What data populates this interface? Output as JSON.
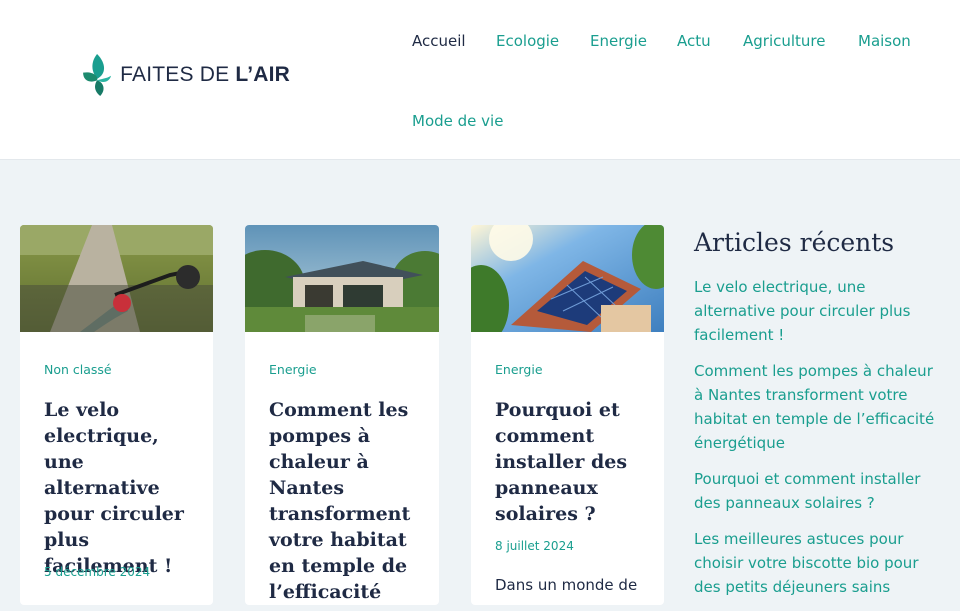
{
  "brand": {
    "name_light": "FAITES DE ",
    "name_bold": "L’AIR",
    "accent": "#1a9e8f"
  },
  "nav": {
    "items": [
      {
        "label": "Accueil",
        "active": true
      },
      {
        "label": "Ecologie",
        "active": false
      },
      {
        "label": "Energie",
        "active": false
      },
      {
        "label": "Actu",
        "active": false
      },
      {
        "label": "Agriculture",
        "active": false
      },
      {
        "label": "Maison",
        "active": false
      },
      {
        "label": "Mode de vie",
        "active": false
      }
    ]
  },
  "posts": [
    {
      "category": "Non classé",
      "title": "Le velo electrique, une alternative pour circuler plus facilement !",
      "date": "5 décembre 2024",
      "excerpt": ""
    },
    {
      "category": "Energie",
      "title": "Comment les pompes à chaleur à Nantes transforment votre habitat en temple de l’efficacité énergétique",
      "date": "",
      "excerpt": ""
    },
    {
      "category": "Energie",
      "title": "Pourquoi et comment installer des panneaux solaires ?",
      "date": "8 juillet 2024",
      "excerpt": "Dans un monde de"
    }
  ],
  "sidebar": {
    "heading": "Articles récents",
    "links": [
      "Le velo electrique, une alternative pour circuler plus facilement !",
      "Comment les pompes à chaleur à Nantes transforment votre habitat en temple de l’efficacité énergétique",
      "Pourquoi et comment installer des panneaux solaires ?",
      "Les meilleures astuces pour choisir votre biscotte bio pour des petits déjeuners sains"
    ]
  }
}
